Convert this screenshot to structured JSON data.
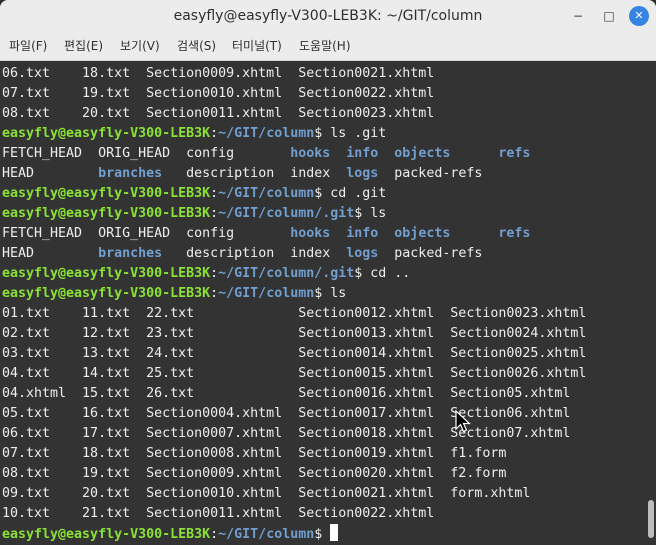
{
  "window": {
    "title": "easyfly@easyfly-V300-LEB3K: ~/GIT/column",
    "controls": {
      "minimize": "−",
      "maximize": "□",
      "close": "✕"
    }
  },
  "menu": [
    "파일(F)",
    "편집(E)",
    "보기(V)",
    "검색(S)",
    "터미널(T)",
    "도움말(H)"
  ],
  "colors": {
    "background": "#333333",
    "text": "#eeeeec",
    "prompt_user": "#8ae234",
    "prompt_path": "#729fcf",
    "directory": "#729fcf"
  },
  "terminal": {
    "prompt": {
      "user": "easyfly@easyfly-V300-LEB3K",
      "sep": ":",
      "suffix": "$"
    },
    "lines": [
      {
        "t": "out",
        "segs": [
          {
            "s": "n",
            "v": "06.txt    18.txt  Section0009.xhtml  Section0021.xhtml"
          }
        ]
      },
      {
        "t": "out",
        "segs": [
          {
            "s": "n",
            "v": "07.txt    19.txt  Section0010.xhtml  Section0022.xhtml"
          }
        ]
      },
      {
        "t": "out",
        "segs": [
          {
            "s": "n",
            "v": "08.txt    20.txt  Section0011.xhtml  Section0023.xhtml"
          }
        ]
      },
      {
        "t": "prompt",
        "path": "~/GIT/column",
        "cmd": " ls .git"
      },
      {
        "t": "out",
        "segs": [
          {
            "s": "n",
            "v": "FETCH_HEAD  ORIG_HEAD  config       "
          },
          {
            "s": "d",
            "v": "hooks"
          },
          {
            "s": "n",
            "v": "  "
          },
          {
            "s": "d",
            "v": "info"
          },
          {
            "s": "n",
            "v": "  "
          },
          {
            "s": "d",
            "v": "objects"
          },
          {
            "s": "n",
            "v": "      "
          },
          {
            "s": "d",
            "v": "refs"
          }
        ]
      },
      {
        "t": "out",
        "segs": [
          {
            "s": "n",
            "v": "HEAD        "
          },
          {
            "s": "d",
            "v": "branches"
          },
          {
            "s": "n",
            "v": "   description  index  "
          },
          {
            "s": "d",
            "v": "logs"
          },
          {
            "s": "n",
            "v": "  packed-refs"
          }
        ]
      },
      {
        "t": "prompt",
        "path": "~/GIT/column",
        "cmd": " cd .git"
      },
      {
        "t": "prompt",
        "path": "~/GIT/column/.git",
        "cmd": " ls"
      },
      {
        "t": "out",
        "segs": [
          {
            "s": "n",
            "v": "FETCH_HEAD  ORIG_HEAD  config       "
          },
          {
            "s": "d",
            "v": "hooks"
          },
          {
            "s": "n",
            "v": "  "
          },
          {
            "s": "d",
            "v": "info"
          },
          {
            "s": "n",
            "v": "  "
          },
          {
            "s": "d",
            "v": "objects"
          },
          {
            "s": "n",
            "v": "      "
          },
          {
            "s": "d",
            "v": "refs"
          }
        ]
      },
      {
        "t": "out",
        "segs": [
          {
            "s": "n",
            "v": "HEAD        "
          },
          {
            "s": "d",
            "v": "branches"
          },
          {
            "s": "n",
            "v": "   description  index  "
          },
          {
            "s": "d",
            "v": "logs"
          },
          {
            "s": "n",
            "v": "  packed-refs"
          }
        ]
      },
      {
        "t": "prompt",
        "path": "~/GIT/column/.git",
        "cmd": " cd .."
      },
      {
        "t": "prompt",
        "path": "~/GIT/column",
        "cmd": " ls"
      },
      {
        "t": "out",
        "segs": [
          {
            "s": "n",
            "v": "01.txt    11.txt  22.txt             Section0012.xhtml  Section0023.xhtml"
          }
        ]
      },
      {
        "t": "out",
        "segs": [
          {
            "s": "n",
            "v": "02.txt    12.txt  23.txt             Section0013.xhtml  Section0024.xhtml"
          }
        ]
      },
      {
        "t": "out",
        "segs": [
          {
            "s": "n",
            "v": "03.txt    13.txt  24.txt             Section0014.xhtml  Section0025.xhtml"
          }
        ]
      },
      {
        "t": "out",
        "segs": [
          {
            "s": "n",
            "v": "04.txt    14.txt  25.txt             Section0015.xhtml  Section0026.xhtml"
          }
        ]
      },
      {
        "t": "out",
        "segs": [
          {
            "s": "n",
            "v": "04.xhtml  15.txt  26.txt             Section0016.xhtml  Section05.xhtml"
          }
        ]
      },
      {
        "t": "out",
        "segs": [
          {
            "s": "n",
            "v": "05.txt    16.txt  Section0004.xhtml  Section0017.xhtml  Section06.xhtml"
          }
        ]
      },
      {
        "t": "out",
        "segs": [
          {
            "s": "n",
            "v": "06.txt    17.txt  Section0007.xhtml  Section0018.xhtml  Section07.xhtml"
          }
        ]
      },
      {
        "t": "out",
        "segs": [
          {
            "s": "n",
            "v": "07.txt    18.txt  Section0008.xhtml  Section0019.xhtml  f1.form"
          }
        ]
      },
      {
        "t": "out",
        "segs": [
          {
            "s": "n",
            "v": "08.txt    19.txt  Section0009.xhtml  Section0020.xhtml  f2.form"
          }
        ]
      },
      {
        "t": "out",
        "segs": [
          {
            "s": "n",
            "v": "09.txt    20.txt  Section0010.xhtml  Section0021.xhtml  form.xhtml"
          }
        ]
      },
      {
        "t": "out",
        "segs": [
          {
            "s": "n",
            "v": "10.txt    21.txt  Section0011.xhtml  Section0022.xhtml"
          }
        ]
      },
      {
        "t": "prompt",
        "path": "~/GIT/column",
        "cmd": " ",
        "cursor": true
      }
    ]
  }
}
